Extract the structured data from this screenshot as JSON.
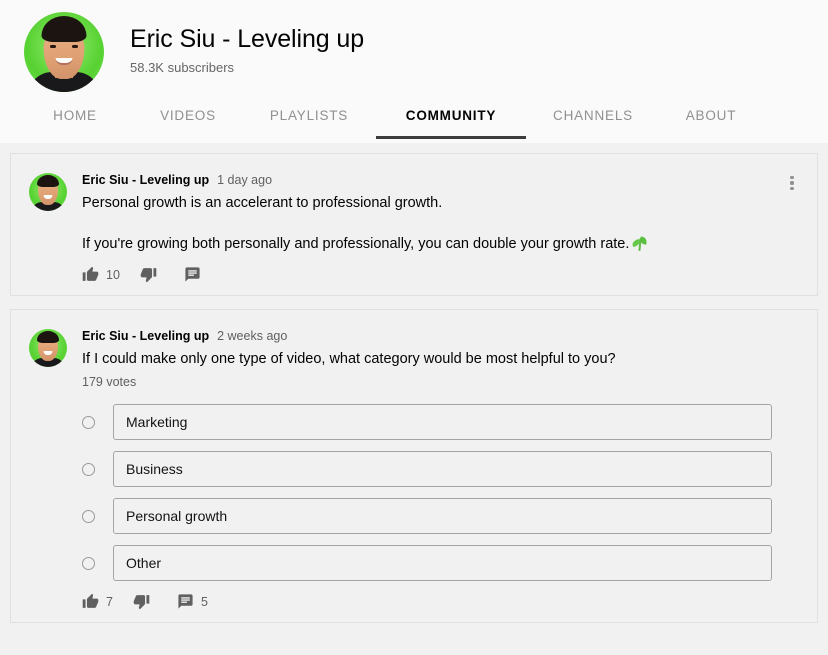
{
  "channel": {
    "name": "Eric Siu - Leveling up",
    "subscribers": "58.3K subscribers",
    "avatar_icon": "channel-avatar-photo"
  },
  "tabs": [
    {
      "label": "HOME",
      "active": false
    },
    {
      "label": "VIDEOS",
      "active": false
    },
    {
      "label": "PLAYLISTS",
      "active": false
    },
    {
      "label": "COMMUNITY",
      "active": true
    },
    {
      "label": "CHANNELS",
      "active": false
    },
    {
      "label": "ABOUT",
      "active": false
    }
  ],
  "posts": [
    {
      "author": "Eric Siu - Leveling up",
      "time": "1 day ago",
      "line1": "Personal growth is an accelerant to professional growth.",
      "line2": "If you're growing both personally and professionally, you can double your growth rate.",
      "emoji": "seedling",
      "like_count": "10",
      "dislike_count": "",
      "comment_count": "",
      "menu_icon": "more-vertical-icon"
    },
    {
      "author": "Eric Siu - Leveling up",
      "time": "2 weeks ago",
      "question": "If I could make only one type of video, what category would be most helpful to you?",
      "votes": "179 votes",
      "options": [
        {
          "label": "Marketing"
        },
        {
          "label": "Business"
        },
        {
          "label": "Personal growth"
        },
        {
          "label": "Other"
        }
      ],
      "like_count": "7",
      "dislike_count": "",
      "comment_count": "5"
    }
  ],
  "colors": {
    "page_bg": "#f1f1f1",
    "header_bg": "#fafafa",
    "active_tab": "#030303",
    "inactive_tab": "#909090",
    "underline": "#3c3c3c",
    "accent_green": "#5fbb46"
  }
}
